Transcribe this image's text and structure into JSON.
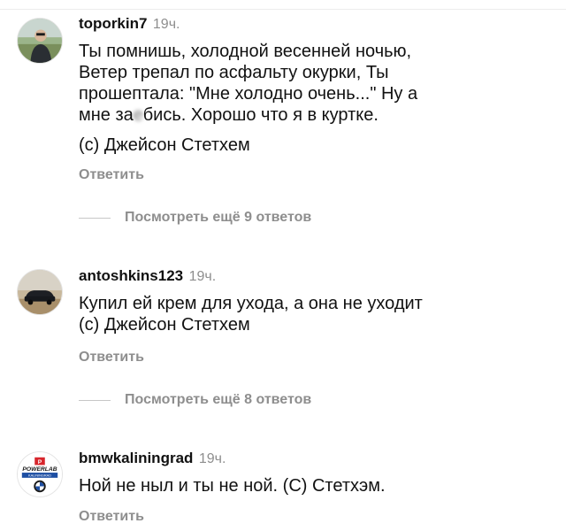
{
  "comments": [
    {
      "username": "toporkin7",
      "time": "19ч.",
      "text_lines_before_blur": "Ты помнишь, холодной весенней ночью,\nВетер трепал по асфальту окурки, Ты\nпрошептала: \"Мне холодно очень...\" Ну а\nмне за",
      "text_blur": "е",
      "text_after_blur": "бись. Хорошо что я в куртке.",
      "signature": "(с) Джейсон Стетхем",
      "reply_label": "Ответить",
      "view_replies_label": "Посмотреть ещё 9 ответов"
    },
    {
      "username": "antoshkins123",
      "time": "19ч.",
      "text": "Купил ей крем для ухода, а она не уходит\n(с) Джейсон Стетхем",
      "reply_label": "Ответить",
      "view_replies_label": "Посмотреть ещё 8 ответов"
    },
    {
      "username": "bmwkaliningrad",
      "time": "19ч.",
      "text": "Ной не ныл и ты не ной. (С) Стетхэм.",
      "reply_label": "Ответить",
      "avatar_logo_text": "POWERLAB",
      "avatar_sub_text": "KALININGRAD"
    }
  ],
  "colors": {
    "text": "#111111",
    "muted": "#8e8e8e",
    "divider": "#c7c7c7",
    "avatar3_red": "#d7262c",
    "avatar3_blue": "#1e4fa3"
  },
  "icons": {
    "avatar1": "person-photo-avatar",
    "avatar2": "car-photo-avatar",
    "avatar3": "powerlab-bmw-logo-avatar"
  }
}
